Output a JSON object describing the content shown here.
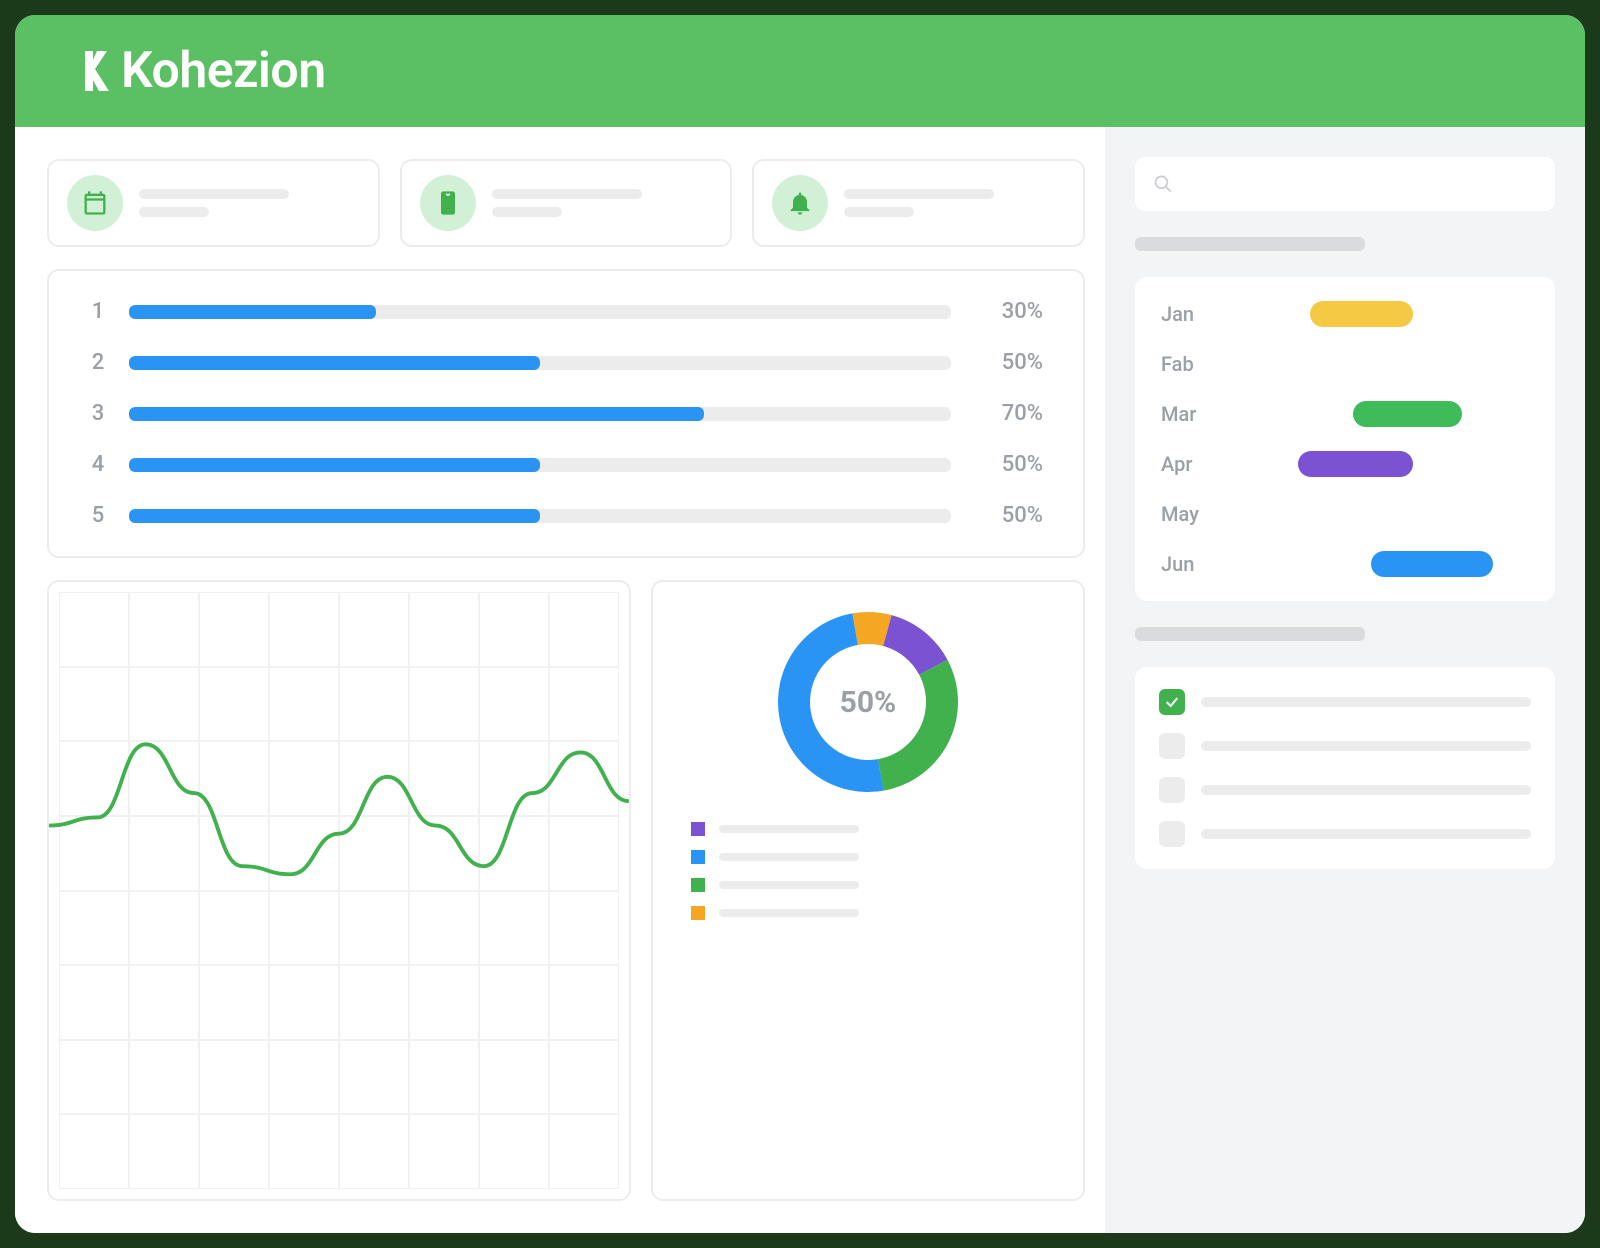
{
  "brand": "Kohezion",
  "colors": {
    "green": "#41b14e",
    "blue": "#2a94f4",
    "purple": "#7b52d1",
    "orange": "#f5a623",
    "yellow": "#f6c944",
    "ganttGreen": "#3fbb5a"
  },
  "topCards": [
    {
      "icon": "calendar"
    },
    {
      "icon": "clipboard"
    },
    {
      "icon": "bell"
    }
  ],
  "search": {
    "placeholder": ""
  },
  "chart_data": [
    {
      "type": "bar",
      "orientation": "horizontal",
      "categories": [
        "1",
        "2",
        "3",
        "4",
        "5"
      ],
      "values": [
        30,
        50,
        70,
        50,
        50
      ],
      "value_suffix": "%",
      "xlim": [
        0,
        100
      ],
      "bar_color": "#2a94f4"
    },
    {
      "type": "line",
      "x": [
        0,
        1,
        2,
        3,
        4,
        5,
        6,
        7,
        8,
        9,
        10,
        11,
        12
      ],
      "y": [
        40,
        42,
        60,
        48,
        30,
        28,
        38,
        52,
        40,
        30,
        48,
        58,
        46
      ],
      "ylim": [
        0,
        100
      ],
      "color": "#41b14e"
    },
    {
      "type": "pie",
      "donut": true,
      "center_label": "50%",
      "series": [
        {
          "name": "Blue",
          "value": 50,
          "color": "#2a94f4"
        },
        {
          "name": "Orange",
          "value": 7,
          "color": "#f5a623"
        },
        {
          "name": "Purple",
          "value": 13,
          "color": "#7b52d1"
        },
        {
          "name": "Green",
          "value": 30,
          "color": "#41b14e"
        }
      ],
      "legend_order": [
        "Purple",
        "Blue",
        "Green",
        "Orange"
      ]
    },
    {
      "type": "gantt",
      "categories": [
        "Jan",
        "Fab",
        "Mar",
        "Apr",
        "May",
        "Jun"
      ],
      "xlim": [
        0,
        100
      ],
      "bars": [
        {
          "row": "Jan",
          "start": 28,
          "end": 62,
          "color": "#f6c944"
        },
        {
          "row": "Mar",
          "start": 42,
          "end": 78,
          "color": "#3fbb5a"
        },
        {
          "row": "Apr",
          "start": 24,
          "end": 62,
          "color": "#7b52d1"
        },
        {
          "row": "Jun",
          "start": 48,
          "end": 88,
          "color": "#2a94f4"
        }
      ]
    }
  ],
  "checklist": {
    "items": [
      {
        "checked": true
      },
      {
        "checked": false
      },
      {
        "checked": false
      },
      {
        "checked": false
      }
    ]
  }
}
